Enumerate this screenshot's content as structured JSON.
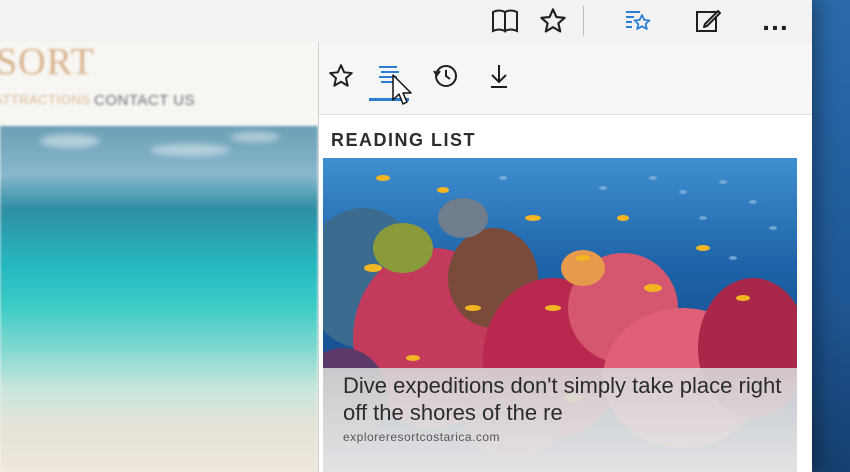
{
  "toolbar": {
    "icons": [
      "reading-view-icon",
      "favorites-star-icon",
      "hub-icon",
      "web-note-icon",
      "more-icon"
    ],
    "more_label": "…",
    "accent_color": "#2a7fd4"
  },
  "site": {
    "logo_text": "SORT",
    "nav_attractions": "ATTRACTIONS",
    "nav_contact": "CONTACT US"
  },
  "hub": {
    "tabs": [
      "favorites",
      "reading-list",
      "history",
      "downloads"
    ],
    "active_tab": "reading-list",
    "title": "READING LIST",
    "card": {
      "title": "Dive expeditions don't simply take place right off the shores of the re",
      "domain": "exploreresortcostarica.com"
    }
  }
}
